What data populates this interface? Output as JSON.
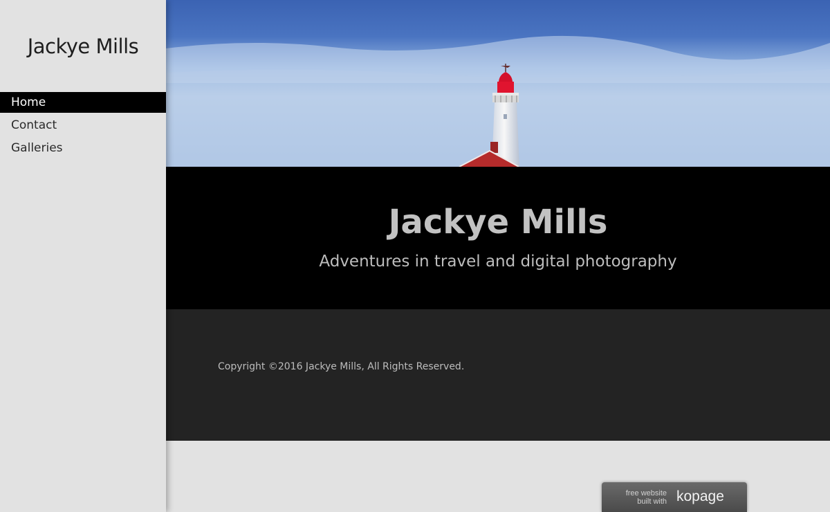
{
  "sidebar": {
    "site_title": "Jackye Mills",
    "nav": [
      {
        "label": "Home",
        "active": true
      },
      {
        "label": "Contact",
        "active": false
      },
      {
        "label": "Galleries",
        "active": false
      }
    ]
  },
  "banner": {
    "title": "Jackye Mills",
    "subtitle": "Adventures in travel and digital photography"
  },
  "footer": {
    "copyright": "Copyright ©2016 Jackye Mills, All Rights Reserved."
  },
  "badge": {
    "line1": "free website",
    "line2": "built with",
    "brand": "kopage"
  },
  "colors": {
    "sidebar_bg": "#e2e2e2",
    "nav_active_bg": "#000000",
    "banner_bg": "#000000",
    "footer_bg": "#232323"
  }
}
